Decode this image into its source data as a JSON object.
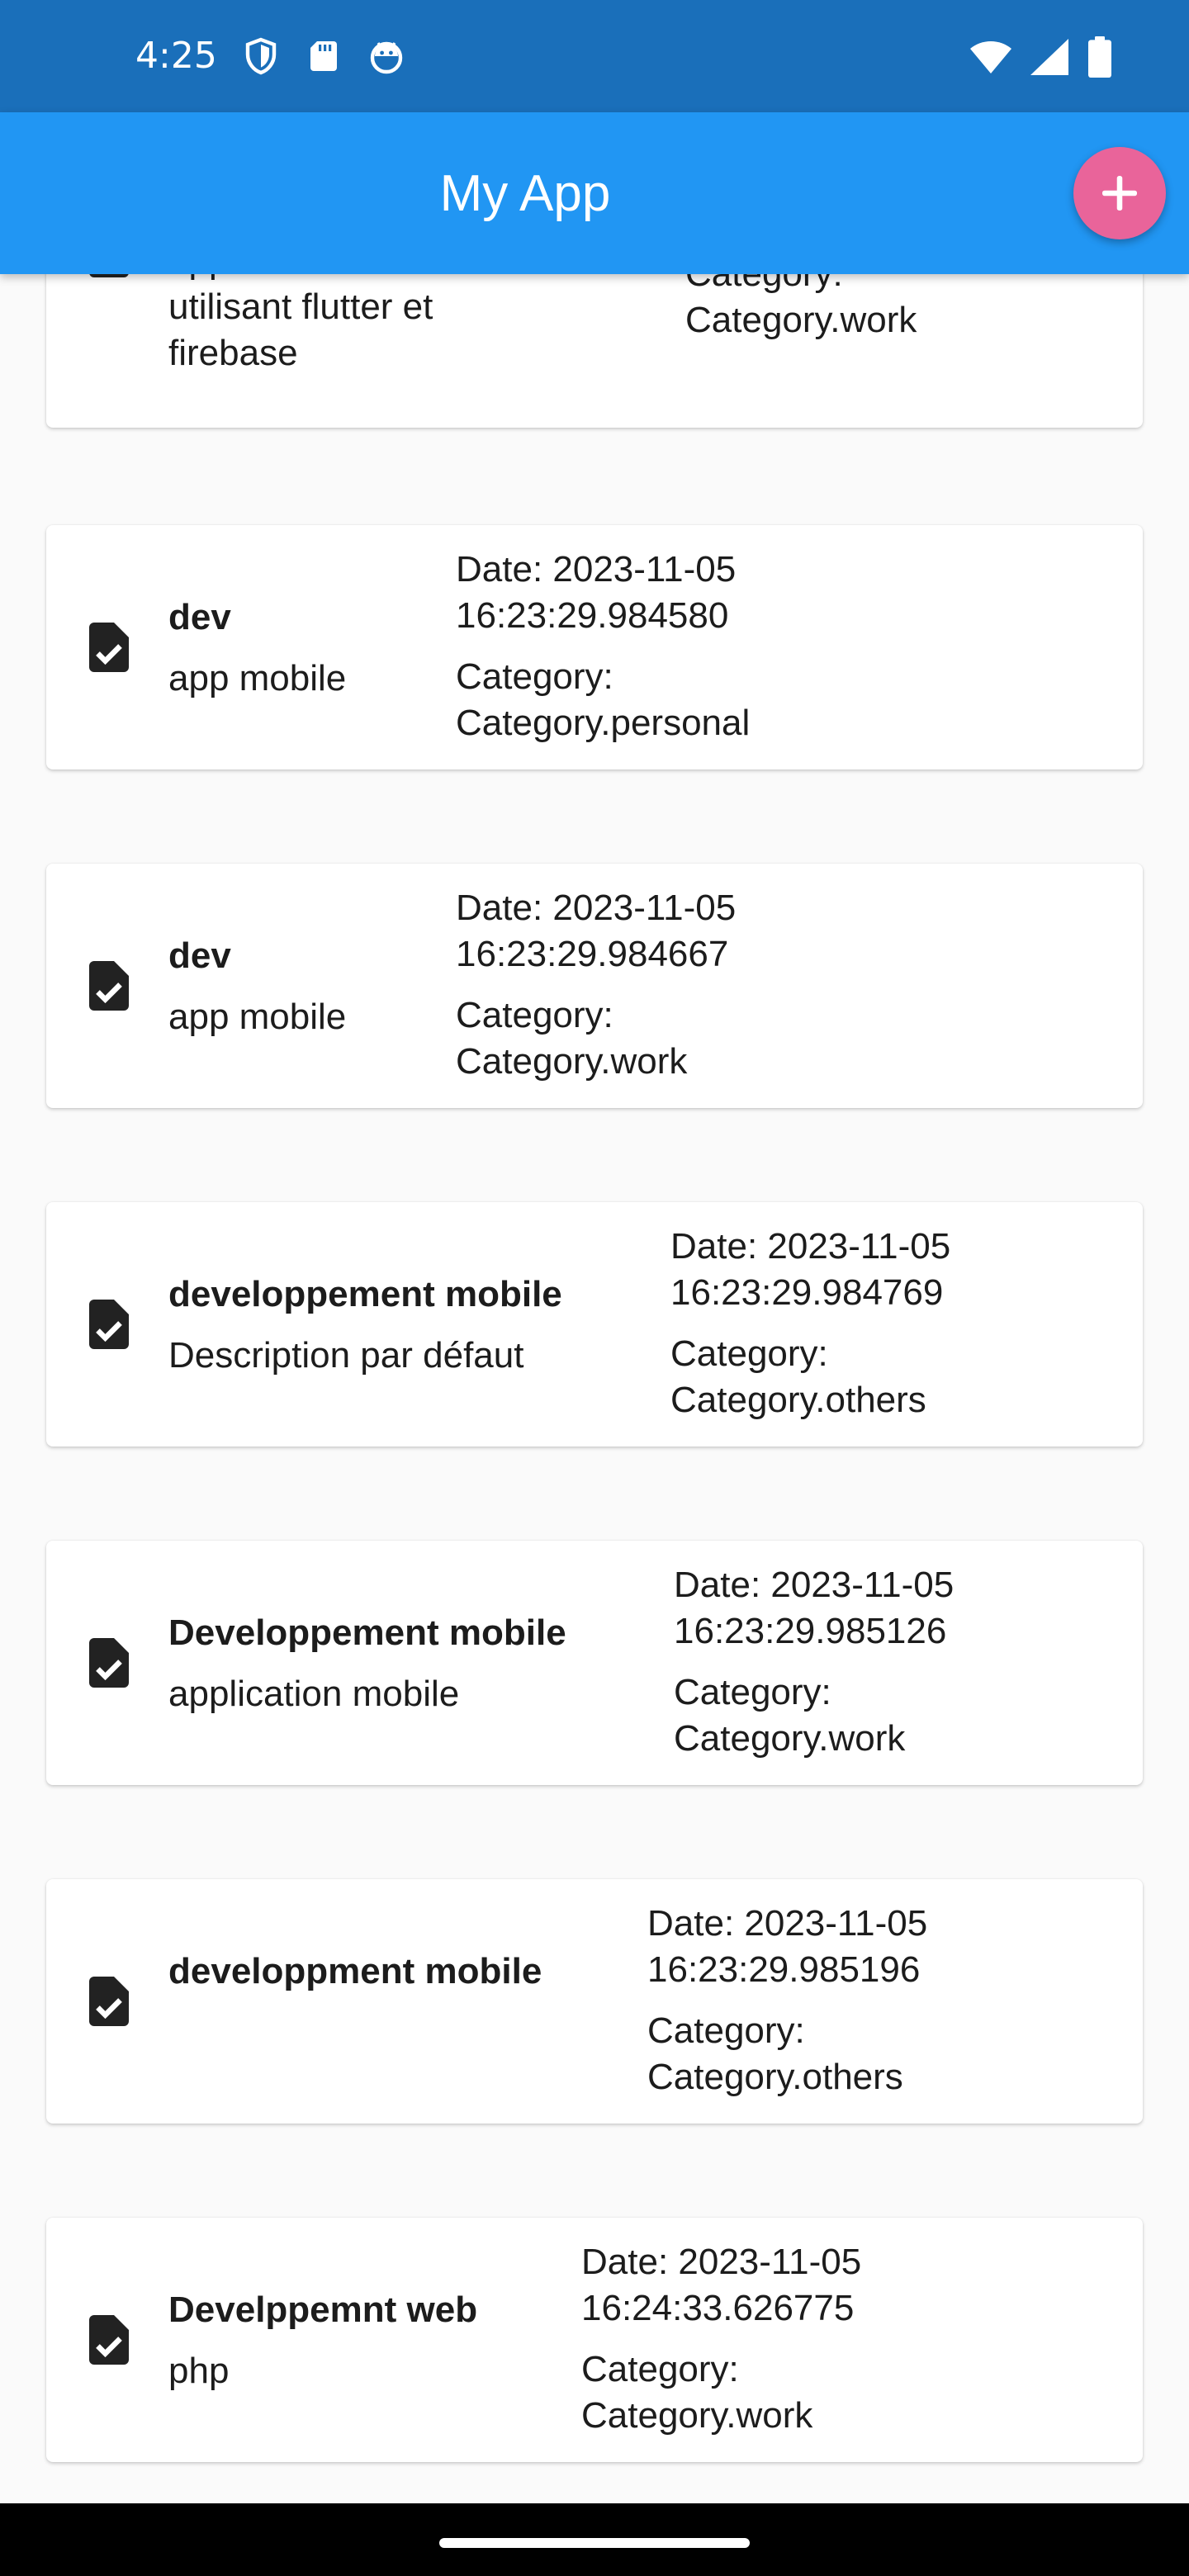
{
  "status_bar": {
    "time": "4:25",
    "left_icons": [
      "shield-icon",
      "sd-card-icon",
      "android-debug-icon"
    ],
    "right_icons": [
      "wifi-icon",
      "signal-icon",
      "battery-icon"
    ]
  },
  "app_bar": {
    "title": "My App",
    "add_button_icon": "plus-icon",
    "accent": "#2196f3",
    "status_color": "#1a6fba",
    "fab_color": "#e9649a"
  },
  "tasks": [
    {
      "title": "",
      "description_lines": [
        "application mobile en",
        "utilisant flutter et",
        "firebase"
      ],
      "date_label": "",
      "date_value": "",
      "category_label": "Category:",
      "category_value": "Category.work"
    },
    {
      "title": "dev",
      "description": "app mobile",
      "date_label": "Date: 2023-11-05",
      "date_value": "16:23:29.984580",
      "category_label": "Category:",
      "category_value": "Category.personal"
    },
    {
      "title": "dev",
      "description": "app mobile",
      "date_label": "Date: 2023-11-05",
      "date_value": "16:23:29.984667",
      "category_label": "Category:",
      "category_value": "Category.work"
    },
    {
      "title": "developpement mobile",
      "description": "Description par défaut",
      "date_label": "Date: 2023-11-05",
      "date_value": "16:23:29.984769",
      "category_label": "Category:",
      "category_value": "Category.others"
    },
    {
      "title": "Developpement mobile",
      "description": "application mobile",
      "date_label": "Date: 2023-11-05",
      "date_value": "16:23:29.985126",
      "category_label": "Category:",
      "category_value": "Category.work"
    },
    {
      "title": "developpment mobile",
      "description": "",
      "date_label": "Date: 2023-11-05",
      "date_value": "16:23:29.985196",
      "category_label": "Category:",
      "category_value": "Category.others"
    },
    {
      "title": "Develppemnt web",
      "description": "php",
      "date_label": "Date: 2023-11-05",
      "date_value": "16:24:33.626775",
      "category_label": "Category:",
      "category_value": "Category.work"
    }
  ]
}
